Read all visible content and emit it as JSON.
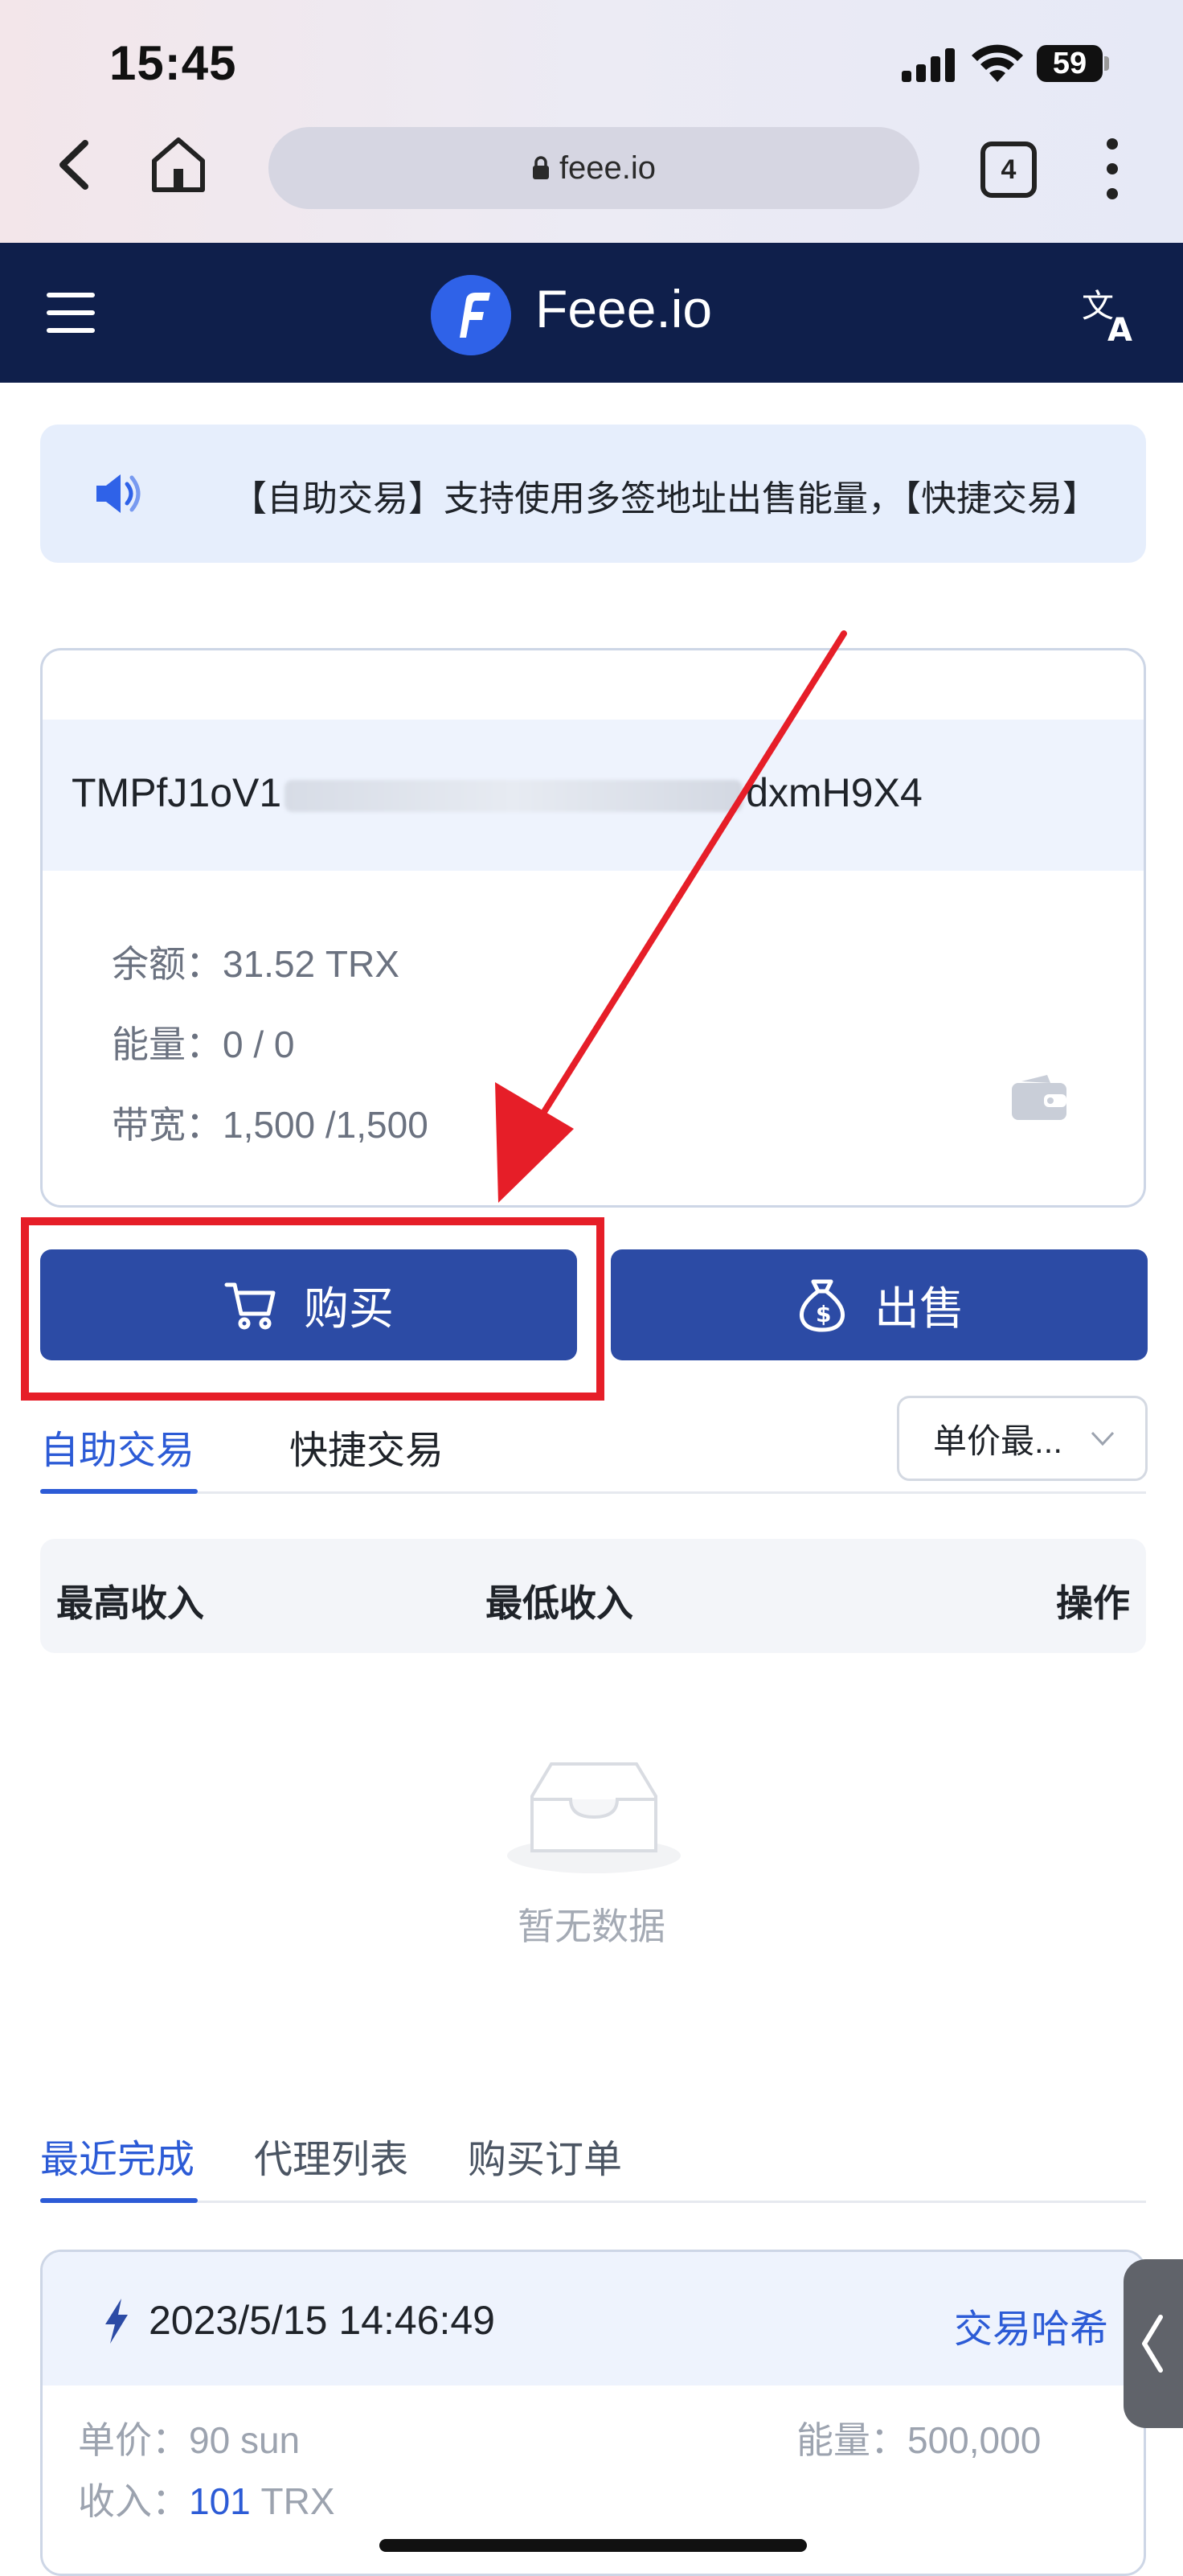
{
  "status_bar": {
    "time": "15:45",
    "battery": "59"
  },
  "browser": {
    "url": "feee.io",
    "tab_count": "4"
  },
  "site": {
    "brand": "Feee.io"
  },
  "notice": {
    "text": "【自助交易】支持使用多签地址出售能量，【快捷交易】"
  },
  "wallet": {
    "address_prefix": "TMPfJ1oV1",
    "address_suffix": "dxmH9X4",
    "balance_label": "余额：",
    "balance_value": "31.52 TRX",
    "energy_label": "能量：",
    "energy_value": "0 / 0",
    "bandwidth_label": "带宽：",
    "bandwidth_value": "1,500 /1,500"
  },
  "actions": {
    "buy_label": "购买",
    "sell_label": "出售"
  },
  "trade_tabs": {
    "tab_self": "自助交易",
    "tab_quick": "快捷交易",
    "sort_label": "单价最..."
  },
  "table": {
    "col_max": "最高收入",
    "col_min": "最低收入",
    "col_action": "操作",
    "empty_text": "暂无数据"
  },
  "bottom_tabs": {
    "recent": "最近完成",
    "agents": "代理列表",
    "orders": "购买订单"
  },
  "recent": {
    "time": "2023/5/15 14:46:49",
    "hash_link": "交易哈希",
    "price_label": "单价：",
    "price_value": "90 sun",
    "energy_label": "能量：",
    "energy_value": "500,000",
    "income_label": "收入：",
    "income_value": "101",
    "income_unit": "TRX"
  },
  "colors": {
    "header_bg": "#0f1f4b",
    "primary": "#2c4ba5",
    "accent_blue": "#2c5bd6",
    "highlight_red": "#e61e28"
  }
}
